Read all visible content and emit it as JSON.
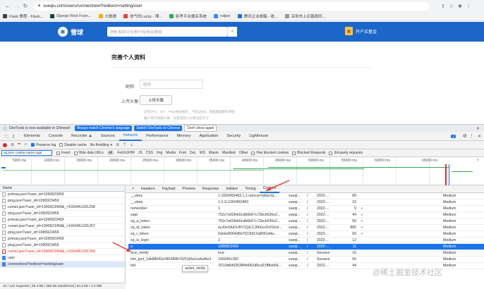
{
  "browser": {
    "url": "xueqiu.com/users/connectnew?redirect=/setting/user",
    "bookmarks": [
      {
        "label": "Flask 教程 - Flask...",
        "color": "#3c4043"
      },
      {
        "label": "Django Rest Fram...",
        "color": "#0c4b33"
      },
      {
        "label": "大数据",
        "color": "#f4b400"
      },
      {
        "label": "信气的Lucky - 博...",
        "color": "#ea4335"
      },
      {
        "label": "新考平台报名系统",
        "color": "#34a853"
      },
      {
        "label": "ruijian",
        "color": "#4285f4"
      },
      {
        "label": "腾讯企业邮箱 - 收...",
        "color": "#1a73e8"
      },
      {
        "label": "深圳市上石镇政府...",
        "color": "#999999"
      }
    ]
  },
  "site": {
    "logo_text": "雪球",
    "search_placeholder": "搜索 股票/讨论/用户/帖/组合/群组",
    "open_account": "开户买基金"
  },
  "page": {
    "title": "完善个人资料",
    "nickname_label": "昵称:",
    "nickname_placeholder": "昵称",
    "avatar_label": "上传头像:",
    "upload_button": "上传头像",
    "hint_line1": "支持JPG、GIF、PNG格式图片，不超过5M。每图都理解利用在",
    "hint_line2": "推介或可保留头像，注意该题小头像当前尺寸"
  },
  "devtools": {
    "notice_text": "DevTools is now available in Chinese!",
    "btn_match": "Always match Chrome's language",
    "btn_switch": "Switch DevTools to Chinese",
    "btn_dont_show": "Don't show again",
    "tabs": [
      "Elements",
      "Console",
      "Recorder ▲",
      "Sources",
      "Network",
      "Performance",
      "Memory",
      "Application",
      "Security",
      "Lighthouse"
    ],
    "active_tab": "Network",
    "badge_count": "1",
    "toolbar": {
      "preserve_log": "Preserve log",
      "disable_cache": "Disable cache",
      "throttling": "No throttling"
    },
    "filter": {
      "value": "qs.json cookie-name:xqat",
      "invert": "Invert",
      "hide_data_urls": "Hide data URLs",
      "types": [
        "All",
        "Fetch/XHR",
        "JS",
        "CSS",
        "Img",
        "Media",
        "Font",
        "Doc",
        "WS",
        "Wasm",
        "Manifest",
        "Other"
      ],
      "blocked_cookies": "Has blocked cookies",
      "blocked_requests": "Blocked Requests",
      "third_party": "3rd-party requests"
    },
    "timeline_ticks": [
      "5000 ms",
      "10000 ms",
      "15000 ms",
      "20000 ms",
      "25000 ms",
      "30000 ms",
      "35000 ms",
      "40000 ms",
      "45000 ms",
      "50000 ms",
      "55000 ms",
      "60000 ms",
      "65000 ms",
      "7"
    ],
    "requests_header": "Name",
    "requests": [
      {
        "name": "primary.json?user_id=1990923459",
        "type": "normal"
      },
      {
        "name": "ping.json?user_id=1990923459",
        "type": "normal"
      },
      {
        "name": "comet.json?user_id=1990923458&_=1650451281258",
        "type": "normal"
      },
      {
        "name": "ping.json?user_id=1990923459",
        "type": "normal"
      },
      {
        "name": "primary.json?user_id=1990923459",
        "type": "normal"
      },
      {
        "name": "comet.json?user_id=1990923458&_=1650451281257",
        "type": "normal"
      },
      {
        "name": "ping.json?user_id=1990923459",
        "type": "normal"
      },
      {
        "name": "primary.json?user_id=1990923459",
        "type": "normal"
      },
      {
        "name": "ping.json?user_id=1990923459",
        "type": "normal"
      },
      {
        "name": "comet.json?user_id=1990923458&_=1650451281258",
        "type": "err"
      },
      {
        "name": "user",
        "type": "normal"
      },
      {
        "name": "connectnew?redirect=/setting/user",
        "type": "sel"
      }
    ],
    "status_bar": "44 / 122 requests  |  36.4 kB / 289 kB transferred  |  94.3 kB / 4.4 MB",
    "detail_tabs": [
      "×",
      "Headers",
      "Payload",
      "Preview",
      "Response",
      "Initiator",
      "Timing",
      "Cookies"
    ],
    "active_detail_tab": "Cookies",
    "cookies": [
      {
        "name": "__utmz",
        "value": "1.1650450483.1.1.utmcsr=(direct)|...",
        "domain": "xueqi...",
        "path": "/",
        "expires": "2022-...",
        "size": "89",
        "httponly": "",
        "secure": "",
        "samesite": "",
        "priority": "Medium"
      },
      {
        "name": "__utma",
        "value": "1.1.1l.1650450483",
        "domain": "xueqi...",
        "path": "/",
        "expires": "2022-...",
        "size": "23",
        "httponly": "",
        "secure": "",
        "samesite": "",
        "priority": "Medium"
      },
      {
        "name": "remember",
        "value": "1",
        "domain": "xueqi...",
        "path": "/",
        "expires": "2022-...",
        "size": "9",
        "httponly": "✓",
        "secure": "",
        "samesite": "",
        "priority": "Medium"
      },
      {
        "name": "xqat",
        "value": "752c7e62feb0cdb6b67c72bcb026e2...",
        "domain": "xueqi...",
        "path": "/",
        "expires": "2022-...",
        "size": "44",
        "httponly": "✓",
        "secure": "",
        "samesite": "",
        "priority": "Medium"
      },
      {
        "name": "xq_a_token",
        "value": "752c7e62feb0cdb6b67c72bcb026e2...",
        "domain": "xueqi...",
        "path": "/",
        "expires": "2022-...",
        "size": "50",
        "httponly": "✓",
        "secure": "",
        "samesite": "",
        "priority": "Medium"
      },
      {
        "name": "xq_id_token",
        "value": "eyJ0eXAiOiJKV1QiLCJhbGciOiJSUzI...",
        "domain": "xueqi...",
        "path": "/",
        "expires": "2022-...",
        "size": "880",
        "httponly": "✓",
        "secure": "",
        "samesite": "",
        "priority": "Medium"
      },
      {
        "name": "xq_r_token",
        "value": "5dcbe8364d5b7022bf12a8061d4a...",
        "domain": "xueqi...",
        "path": "/",
        "expires": "2022-...",
        "size": "50",
        "httponly": "✓",
        "secure": "",
        "samesite": "",
        "priority": "Medium"
      },
      {
        "name": "xq_is_login",
        "value": "1",
        "domain": "xueqi...",
        "path": "/",
        "expires": "2022-...",
        "size": "12",
        "httponly": "",
        "secure": "",
        "samesite": "",
        "priority": "Medium"
      },
      {
        "name": "u",
        "value": "1990923459",
        "domain": "xueqi...",
        "path": "/",
        "expires": "2022-...",
        "size": "11",
        "httponly": "",
        "secure": "",
        "samesite": "",
        "priority": "Medium"
      },
      {
        "name": "acw_minify",
        "value": "true",
        "domain": "xueqi...",
        "path": "/",
        "expires": "Session",
        "size": "16",
        "httponly": "",
        "secure": "",
        "samesite": "",
        "priority": "Medium"
      },
      {
        "name": "Hm_lpvt_1db88642e346389874251b5a1eded6e3",
        "value": "1650451282",
        "domain": "xueqi...",
        "path": "/",
        "expires": "Session",
        "size": "50",
        "httponly": "",
        "secure": "",
        "samesite": "",
        "priority": "Medium"
      },
      {
        "name": "bid",
        "value": "1f110d6d43538f4d062d5cd21ff8eb54...",
        "domain": "xueqi...",
        "path": "/",
        "expires": "2022-...",
        "size": "44",
        "httponly": "",
        "secure": "",
        "samesite": "",
        "priority": "Medium"
      }
    ],
    "selected_cookie": "u",
    "tooltip": "acbim_minify"
  },
  "watermark": "@稀土掘金技术社区",
  "colors": {
    "accent": "#1a73e8",
    "brand": "#1b66c9",
    "error": "#d93025"
  }
}
